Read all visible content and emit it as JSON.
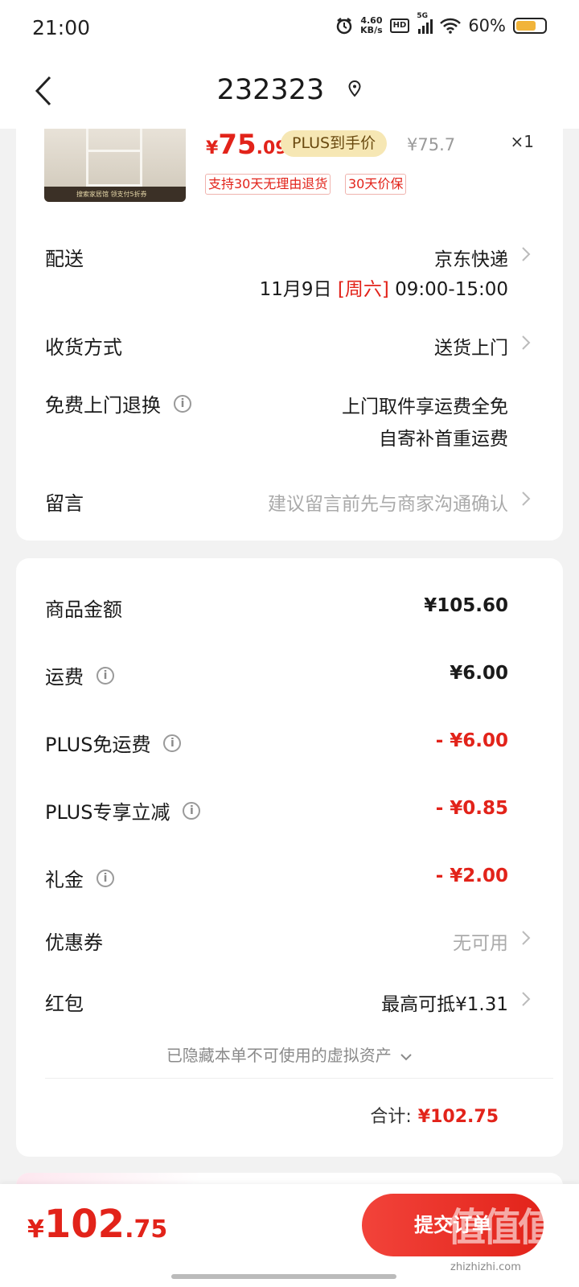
{
  "status_bar": {
    "time": "21:00",
    "speed_value": "4.60",
    "speed_unit": "KB/s",
    "hd": "HD",
    "network": "5G",
    "battery": "60%"
  },
  "nav": {
    "title": "232323",
    "icons": [
      "back-arrow-icon",
      "location-pin-icon"
    ]
  },
  "product": {
    "price_symbol": "¥",
    "price_int": "75",
    "price_dec": ".09",
    "plus_label": "PLUS到手价",
    "original_price": "¥75.7",
    "quantity": "×1",
    "tags": [
      "支持30天无理由退货",
      "30天价保"
    ],
    "banner_text": "搜索家居馆 领支付5折券"
  },
  "shipping": {
    "label": "配送",
    "carrier": "京东快递",
    "date": "11月9日",
    "weekday": "[周六]",
    "time_slot": "09:00-15:00"
  },
  "receive": {
    "label": "收货方式",
    "value": "送货上门"
  },
  "free_return": {
    "label": "免费上门退换",
    "line1": "上门取件享运费全免",
    "line2": "自寄补首重运费"
  },
  "message": {
    "label": "留言",
    "placeholder": "建议留言前先与商家沟通确认"
  },
  "costs": {
    "goods_label": "商品金额",
    "goods_value": "¥105.60",
    "freight_label": "运费",
    "freight_value": "¥6.00",
    "plus_free_label": "PLUS免运费",
    "plus_free_value": "- ¥6.00",
    "plus_discount_label": "PLUS专享立减",
    "plus_discount_value": "- ¥0.85",
    "gift_label": "礼金",
    "gift_value": "- ¥2.00",
    "coupon_label": "优惠券",
    "coupon_value": "无可用",
    "redpack_label": "红包",
    "redpack_value": "最高可抵¥1.31",
    "hidden_assets": "已隐藏本单不可使用的虚拟资产",
    "total_label": "合计:",
    "total_value": "¥102.75"
  },
  "bottom_bar": {
    "price_symbol": "¥",
    "price_int": "102",
    "price_dec": ".75",
    "submit_label": "提交订单",
    "watermark": "值值值",
    "watermark_url": "zhizhizhi.com"
  },
  "colors": {
    "accent_red": "#e2231a",
    "plus_gold": "#f6e7b4",
    "background": "#f2f2f2"
  }
}
